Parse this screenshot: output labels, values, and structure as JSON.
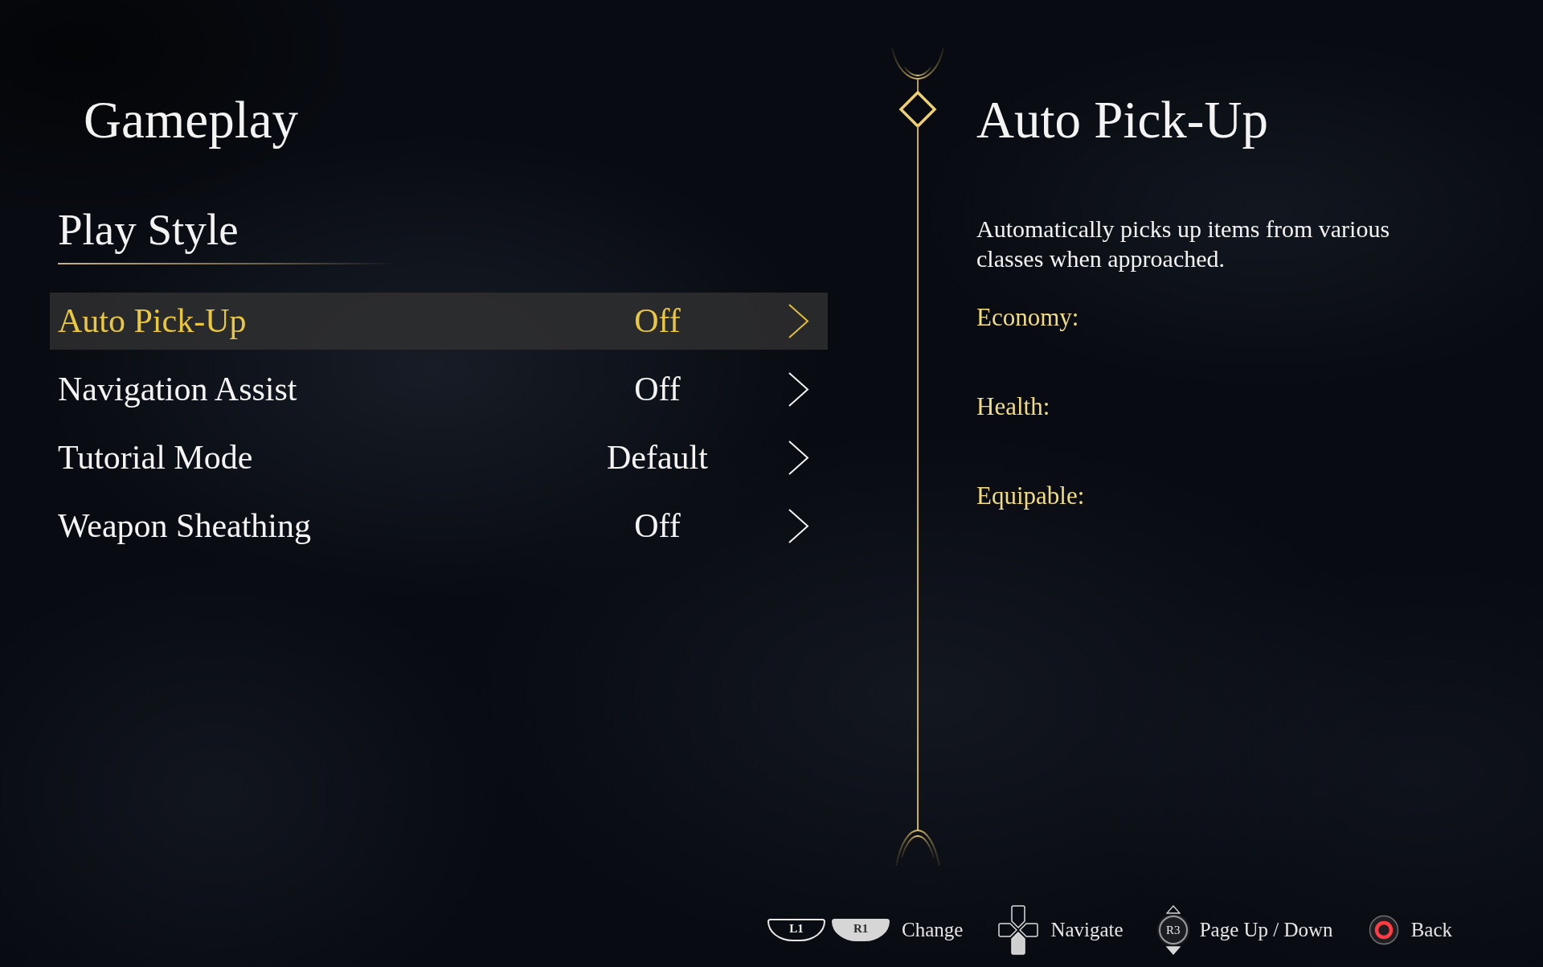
{
  "menu": {
    "title": "Gameplay",
    "section_title": "Play Style"
  },
  "settings": [
    {
      "label": "Auto Pick-Up",
      "value": "Off",
      "selected": true
    },
    {
      "label": "Navigation Assist",
      "value": "Off",
      "selected": false
    },
    {
      "label": "Tutorial Mode",
      "value": "Default",
      "selected": false
    },
    {
      "label": "Weapon Sheathing",
      "value": "Off",
      "selected": false
    }
  ],
  "detail": {
    "title": "Auto Pick-Up",
    "description": "Automatically picks up items from various classes when approached.",
    "fields": [
      "Economy:",
      "Health:",
      "Equipable:"
    ]
  },
  "button_hints": [
    {
      "kind": "shoulder",
      "keys": [
        {
          "label": "L1",
          "highlighted": false
        },
        {
          "label": "R1",
          "highlighted": true
        }
      ],
      "label": "Change"
    },
    {
      "kind": "dpad",
      "down_highlighted": true,
      "label": "Navigate"
    },
    {
      "kind": "stick",
      "key": "R3",
      "down_highlighted": true,
      "label": "Page Up / Down"
    },
    {
      "kind": "circle",
      "label": "Back"
    }
  ]
}
